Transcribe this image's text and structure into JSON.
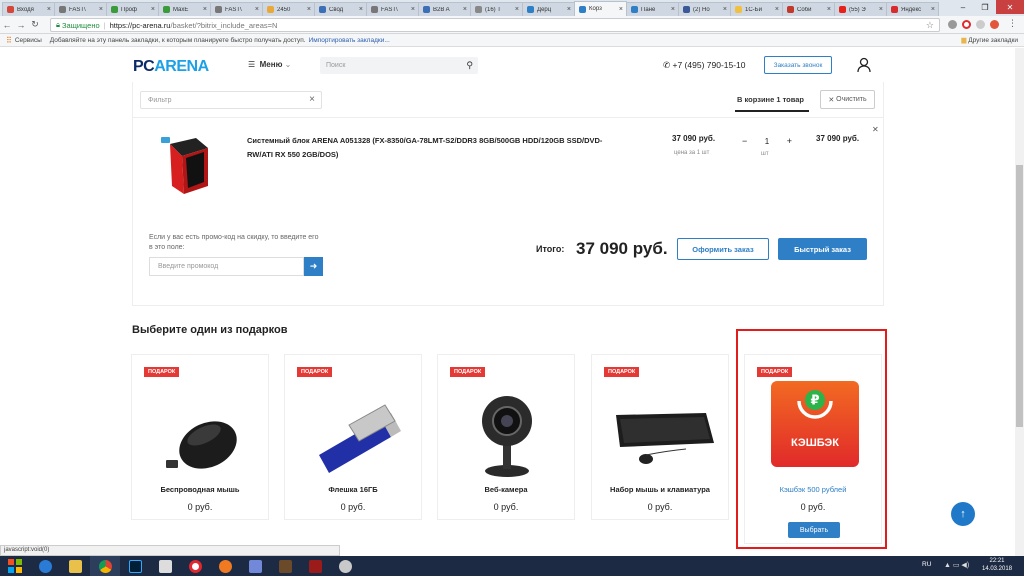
{
  "browser": {
    "tabs": [
      {
        "label": "Входя",
        "color": "#d44638",
        "active": false
      },
      {
        "label": "FAST\\",
        "color": "#777777",
        "active": false
      },
      {
        "label": "Проф",
        "color": "#3a9b3a",
        "active": false
      },
      {
        "label": "MaxE",
        "color": "#3a9b3a",
        "active": false
      },
      {
        "label": "FAST\\",
        "color": "#777777",
        "active": false
      },
      {
        "label": "2450",
        "color": "#e8a93a",
        "active": false
      },
      {
        "label": "Свод",
        "color": "#3b6fb6",
        "active": false
      },
      {
        "label": "FAST\\",
        "color": "#777777",
        "active": false
      },
      {
        "label": "B2B A",
        "color": "#3b6fb6",
        "active": false
      },
      {
        "label": "(16) T",
        "color": "#888888",
        "active": false
      },
      {
        "label": "Дерц",
        "color": "#2e7fc6",
        "active": false
      },
      {
        "label": "Корз",
        "color": "#2e7fc6",
        "active": true
      },
      {
        "label": "Пане",
        "color": "#2e7fc6",
        "active": false
      },
      {
        "label": "(2) Но",
        "color": "#3b5998",
        "active": false
      },
      {
        "label": "1С-Би",
        "color": "#f0c040",
        "active": false
      },
      {
        "label": "Соби",
        "color": "#c0392b",
        "active": false
      },
      {
        "label": "(55) Э",
        "color": "#e62117",
        "active": false
      },
      {
        "label": "Яндекс",
        "color": "#d82c2c",
        "active": false
      }
    ],
    "secure_label": "Защищено",
    "url_host": "https://pc-arena.ru",
    "url_path": "/basket/?bitrix_include_areas=N",
    "bookmarks_services": "Сервисы",
    "bookmarks_hint": "Добавляйте на эту панель закладки, к которым планируете быстро получать доступ.",
    "bookmarks_import": "Импортировать закладки...",
    "bookmarks_other": "Другие закладки"
  },
  "header": {
    "logo_pc": "PC",
    "logo_arena": "ARENA",
    "menu_label": "Меню",
    "search_placeholder": "Поиск",
    "phone": "+7 (495) 790-15-10",
    "callback_label": "Заказать звонок"
  },
  "basket": {
    "filter_placeholder": "Фильтр",
    "in_cart": "В корзине 1 товар",
    "clear_label": "Очистить",
    "item": {
      "name": "Системный блок ARENA A051328 (FX-8350/GA-78LMT-S2/DDR3 8GB/500GB HDD/120GB SSD/DVD-RW/ATI RX 550 2GB/DOS)",
      "price": "37 090 руб.",
      "price_note": "цена за 1 шт",
      "qty": "1",
      "qty_minus": "−",
      "qty_plus": "+",
      "qty_unit": "шт",
      "sum": "37 090 руб."
    },
    "promo_hint": "Если у вас есть промо-код на скидку, то введите его в это поле:",
    "promo_placeholder": "Введите промокод",
    "total_label": "Итого:",
    "total_value": "37 090 руб.",
    "order_label": "Оформить заказ",
    "quick_label": "Быстрый заказ"
  },
  "gifts": {
    "title": "Выберите один из подарков",
    "badge": "ПОДАРОК",
    "items": [
      {
        "name": "Беспроводная мышь",
        "price": "0 руб."
      },
      {
        "name": "Флешка 16ГБ",
        "price": "0 руб."
      },
      {
        "name": "Веб-камера",
        "price": "0 руб."
      },
      {
        "name": "Набор мышь и клавиатура",
        "price": "0 руб."
      },
      {
        "name": "Кэшбэк 500 рублей",
        "price": "0 руб."
      }
    ],
    "cashback_logo_text": "КЭШБЭК",
    "choose_label": "Выбрать"
  },
  "status_text": "javascript:void(0)",
  "taskbar": {
    "lang": "RU",
    "time": "22:21",
    "date": "14.03.2018"
  }
}
